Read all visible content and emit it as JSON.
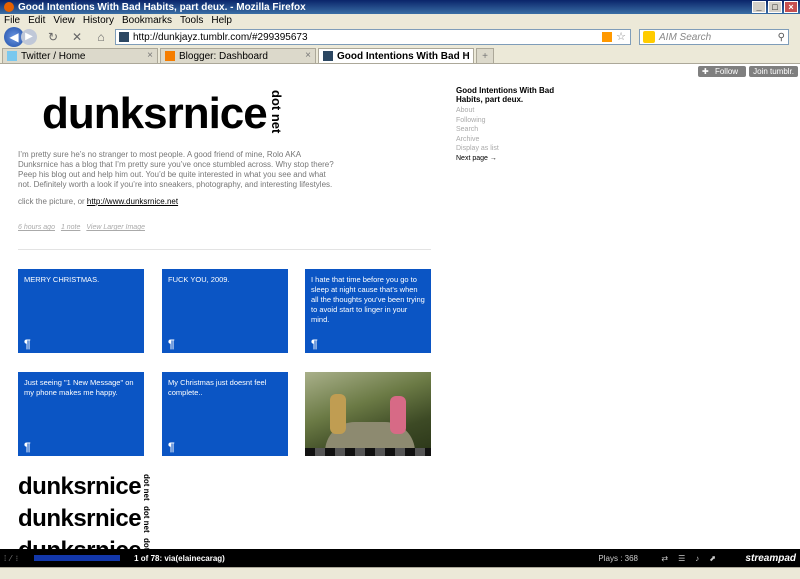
{
  "window": {
    "title": "Good Intentions With Bad Habits, part deux. - Mozilla Firefox"
  },
  "menu": [
    "File",
    "Edit",
    "View",
    "History",
    "Bookmarks",
    "Tools",
    "Help"
  ],
  "nav": {
    "url": "http://dunkjayz.tumblr.com/#299395673",
    "search_placeholder": "AIM Search"
  },
  "tabs": [
    {
      "label": "Twitter / Home",
      "active": false
    },
    {
      "label": "Blogger: Dashboard",
      "active": false
    },
    {
      "label": "Good Intentions With Bad Habits,...",
      "active": true
    }
  ],
  "tumblr_controls": {
    "follow": "Follow",
    "join": "Join tumblr."
  },
  "post": {
    "logo_main": "dunksrnice",
    "logo_side": "dot net",
    "text": "I’m pretty sure he’s no stranger to most people. A good friend of mine, Rolo AKA Dunksrnice has a blog that I’m pretty sure you’ve once stumbled across. Why stop there? Peep his blog out and help him out. You’d be quite interested in what you see and what not. Definitely worth a look if you’re into sneakers, photography, and interesting lifestyles.",
    "click_prefix": "click the picture, or ",
    "link": "http://www.dunksrnice.net",
    "meta": [
      "6 hours ago",
      "1 note",
      "View Larger Image"
    ]
  },
  "sidebar": {
    "title": "Good Intentions With Bad Habits, part deux.",
    "links": [
      "About",
      "Following",
      "Search",
      "Archive",
      "Display as list"
    ],
    "next": "Next page →"
  },
  "tiles": [
    {
      "text": "MERRY CHRISTMAS."
    },
    {
      "text": "FUCK YOU, 2009."
    },
    {
      "text": "I hate that time before you go to sleep at night cause that’s when all the thoughts you’ve been trying to avoid start to linger in your mind."
    },
    {
      "text": "Just seeing \"1 New Message\" on my phone makes me happy."
    },
    {
      "text": "My Christmas just doesnt feel complete.."
    }
  ],
  "tile_mark": "¶",
  "player": {
    "track": "1 of 78:  via(elainecarag)",
    "plays": "Plays : 368",
    "brand": "streampad"
  },
  "colors": {
    "tile_blue": "#0b55c4",
    "player_bg": "#000000"
  }
}
